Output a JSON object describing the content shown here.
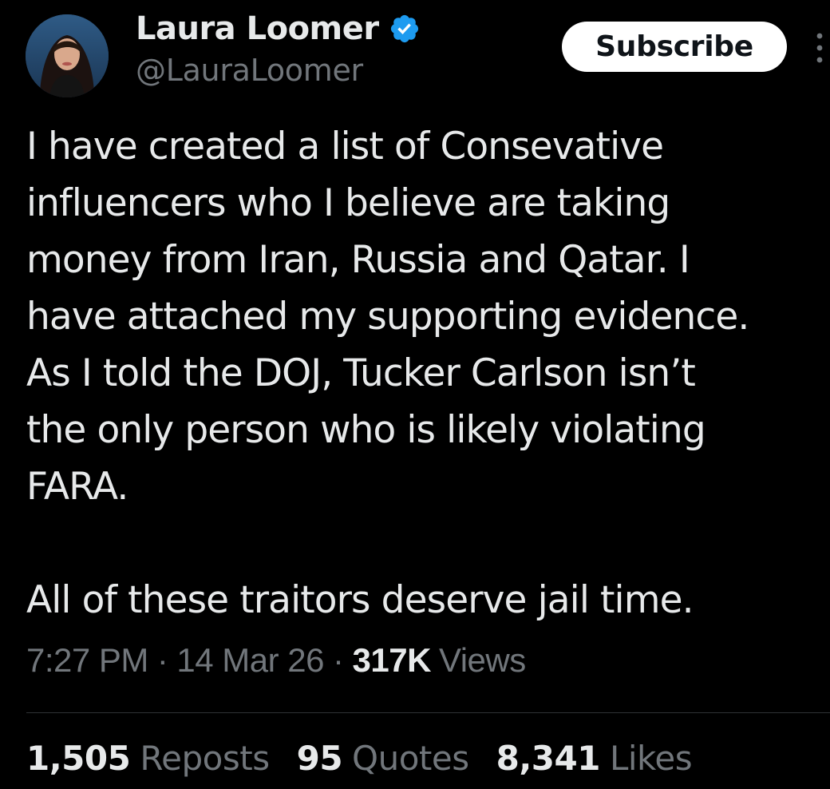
{
  "author": {
    "display_name": "Laura Loomer",
    "handle": "@LauraLoomer",
    "verified_icon": "verified-badge-icon",
    "avatar_icon": "profile-avatar"
  },
  "actions": {
    "subscribe_label": "Subscribe",
    "more_icon": "more-vertical-icon"
  },
  "tweet": {
    "text": "I have created a list of Consevative\ninfluencers who I believe are taking\nmoney from Iran, Russia and Qatar. I\nhave attached my supporting evidence.\nAs I told the DOJ, Tucker Carlson isn’t\nthe only person who is likely violating\nFARA.\n\nAll of these traitors deserve jail time."
  },
  "meta": {
    "time": "7:27 PM",
    "separator": "·",
    "date": "14 Mar 26",
    "views_count": "317K",
    "views_label": "Views"
  },
  "stats": {
    "reposts_count": "1,505",
    "reposts_label": "Reposts",
    "quotes_count": "95",
    "quotes_label": "Quotes",
    "likes_count": "8,341",
    "likes_label": "Likes"
  },
  "colors": {
    "background": "#000000",
    "primary_text": "#e7e9ea",
    "secondary_text": "#71767b",
    "verified_blue": "#1d9bf0",
    "button_bg": "#ffffff",
    "divider": "#2f3336"
  }
}
